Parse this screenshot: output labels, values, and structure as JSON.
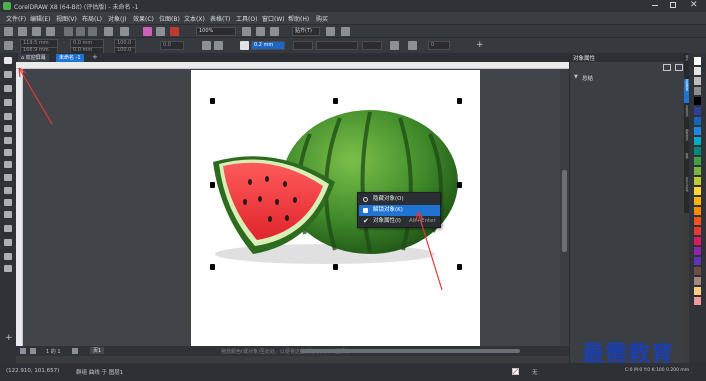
{
  "app": {
    "title": "CorelDRAW X8 (64-Bit) (评估版) - 未命名 -1"
  },
  "menu": [
    "文件(F)",
    "编辑(E)",
    "视图(V)",
    "布局(L)",
    "对象(J)",
    "效果(C)",
    "位图(B)",
    "文本(X)",
    "表格(T)",
    "工具(O)",
    "窗口(W)",
    "帮助(H)",
    "购买"
  ],
  "toolbar": {
    "zoom": "100%",
    "snap": "贴齐(T)",
    "outline_width": "0.2 mm",
    "angle": "0"
  },
  "property_bar": {
    "x": "119.5 mm",
    "y": "166.9 mm",
    "w": "0.0 mm",
    "h": "0.0 mm",
    "sx": "100.0",
    "sy": "100.0",
    "rot": "0.0"
  },
  "tabs": {
    "welcome": "欢迎屏幕",
    "doc": "未命名 -1"
  },
  "context_menu": {
    "items": [
      "隐藏对象(O)",
      "解锁对象(K)",
      "对象属性(I)"
    ],
    "shortcut": "Alt+Enter",
    "selected_index": 1
  },
  "page_nav": {
    "count": "1 的 1",
    "page": "页1"
  },
  "canvas_hint": "拖放颜色(或对象)至此处，以便将这些颜色与文档一起保存",
  "status": {
    "coords": "(122.910, 101.657)",
    "selection": "群组 曲线 于 图层1",
    "fill": "无",
    "color_info": "C:0 M:0 Y:0 K:100  0.200 mm"
  },
  "docker": {
    "title": "对象属性",
    "section": "总结",
    "side_tabs": [
      "提示",
      "对象属性",
      "对象样式",
      "颜色样式",
      "变换",
      "对齐与分布"
    ]
  },
  "palette": {
    "colors": [
      "#ffffff",
      "#e5e5e5",
      "#bdbdbd",
      "#8c8c8c",
      "#000000",
      "#2c3f99",
      "#1565c0",
      "#1e88e5",
      "#00acc1",
      "#00897b",
      "#43a047",
      "#7cb342",
      "#c0ca33",
      "#fdd835",
      "#ffb300",
      "#fb8c00",
      "#f4511e",
      "#e53935",
      "#d81b60",
      "#8e24aa",
      "#5e35b1",
      "#6d4c41",
      "#a1887f",
      "#ffcc80",
      "#ef9a9a"
    ]
  },
  "watermark": "最需教育"
}
